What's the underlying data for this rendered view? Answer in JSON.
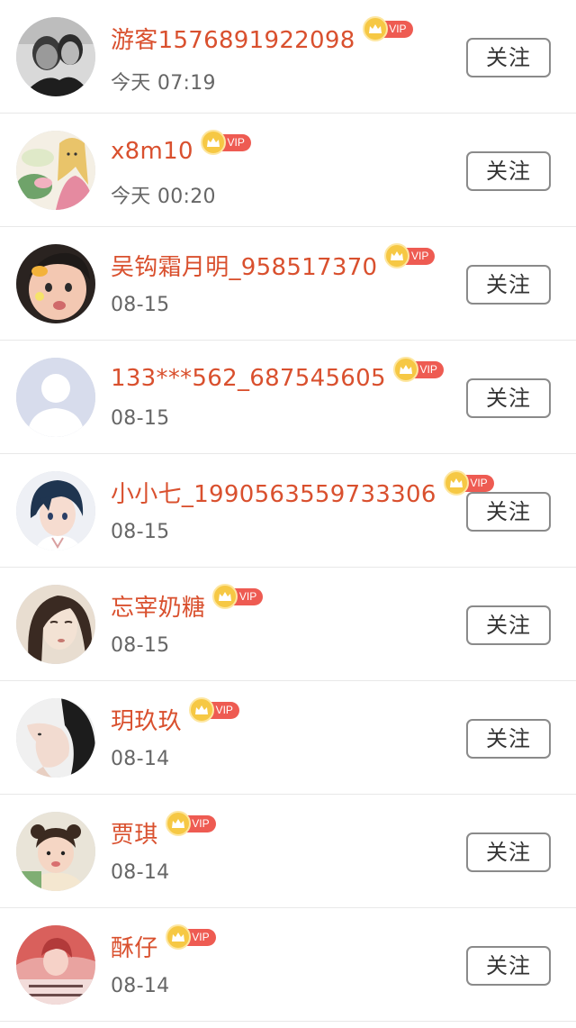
{
  "follow_label": "关注",
  "vip_label": "VIP",
  "colors": {
    "name": "#d9502e",
    "vip_badge": "#ee5b52",
    "crown": "#f6c844",
    "time": "#666666",
    "button_border": "#8a8a8a"
  },
  "users": [
    {
      "name": "游客1576891922098",
      "time": "今天 07:19",
      "avatar": "black-white-couple-photo"
    },
    {
      "name": "x8m10",
      "time": "今天 00:20",
      "avatar": "anime-girl-with-flowers"
    },
    {
      "name": "吴钩霜月明_958517370",
      "time": "08-15",
      "avatar": "baby-face-photo"
    },
    {
      "name": "133***562_687545605",
      "time": "08-15",
      "avatar": "default-person-silhouette"
    },
    {
      "name": "小小七_1990563559733306",
      "time": "08-15",
      "avatar": "anime-boy"
    },
    {
      "name": "忘宰奶糖",
      "time": "08-15",
      "avatar": "illustrated-woman-portrait"
    },
    {
      "name": "玥玖玖",
      "time": "08-14",
      "avatar": "woman-profile-photo"
    },
    {
      "name": "贾琪",
      "time": "08-14",
      "avatar": "little-girl-photo"
    },
    {
      "name": "酥仔",
      "time": "08-14",
      "avatar": "red-artwork-with-text"
    }
  ]
}
